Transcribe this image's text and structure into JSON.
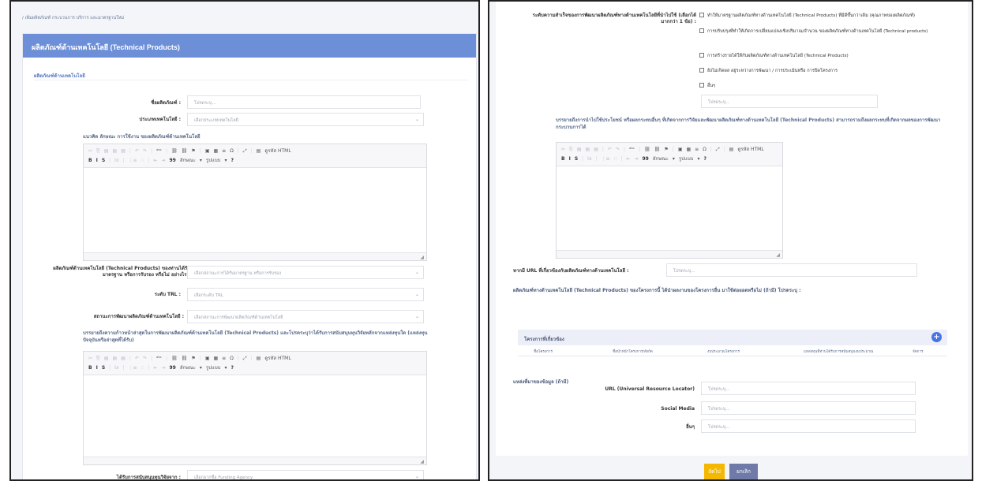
{
  "colors": {
    "header": "#6c8fd8",
    "primary_button": "#f5b800",
    "cancel_button": "#6f7aa8",
    "add_button": "#4674e8"
  },
  "left": {
    "breadcrumb": "/ เพิ่มผลิตภัณฑ์ กระบวนการ บริการ และมาตรฐานใหม่",
    "card_title": "ผลิตภัณฑ์ด้านเทคโนโลยี (Technical Products)",
    "section_title": "ผลิตภัณฑ์ด้านเทคโนโลยี",
    "product_name": {
      "label": "ชื่อผลิตภัณฑ์ :",
      "placeholder": "โปรดระบุ..."
    },
    "tech_type": {
      "label": "ประเภทเทคโนโลยี :",
      "placeholder": "เลือกประเภทเทคโนโลยี"
    },
    "concept_label": "แนวคิด ลักษณะ การใช้งาน ของผลิตภัณฑ์ด้านเทคโนโลยี",
    "certification": {
      "label": "ผลิตภัณฑ์ด้านเทคโนโลยี (Technical Products) ของท่านได้รับมาตรฐาน หรือการรับรอง หรือไม่ อย่างไร :",
      "placeholder": "เลือกสถานะการได้รับมาตรฐาน หรือการรับรอง"
    },
    "trl": {
      "label": "ระดับ TRL :",
      "placeholder": "เลือกระดับ TRL"
    },
    "dev_status": {
      "label": "สถานะการพัฒนาผลิตภัณฑ์ด้านเทคโนโลยี :",
      "placeholder": "เลือกสถานะการพัฒนาผลิตภัณฑ์ด้านเทคโนโลยี"
    },
    "progress_label": "บรรยายถึงความก้าวหน้าล่าสุดในการพัฒนาผลิตภัณฑ์ด้านเทคโนโลยี (Technical Products) และโปรดระบุว่าได้รับการสนับสนุนทุนวิจัยหลักจากแหล่งทุนใด (แหล่งทุนปัจจุบันหรือล่าสุดที่ได้รับ)",
    "funding": {
      "label": "ได้รับการสนับสนุนทุนวิจัยจาก :",
      "placeholder": "เลือกจากชื่อ Funding Agency"
    }
  },
  "editor": {
    "source_label": "ดูรหัส HTML",
    "style_label": "ลักษณะ",
    "format_label": "รูปแบบ",
    "quote": "99",
    "help": "?",
    "row1_icons": [
      "cut-icon",
      "copy-icon",
      "paste-icon",
      "paste-text-icon",
      "paste-word-icon",
      "undo-icon",
      "redo-icon",
      "spellcheck-icon",
      "link-icon",
      "unlink-icon",
      "anchor-icon",
      "image-icon",
      "table-icon",
      "hr-icon",
      "special-char-icon",
      "maximize-icon",
      "source-icon"
    ],
    "row1_glyphs": [
      "✂",
      "⎘",
      "▤",
      "▤",
      "▤",
      "↶",
      "↷",
      "ᵃᵇᶜ",
      "⛓",
      "⛓",
      "⚑",
      "▣",
      "▦",
      "≡",
      "Ω",
      "⤢",
      "▤"
    ],
    "row2_icons": [
      "bold-icon",
      "italic-icon",
      "strike-icon",
      "remove-format-icon",
      "numbered-list-icon",
      "bullet-list-icon",
      "outdent-icon",
      "indent-icon"
    ],
    "row2_glyphs": [
      "B",
      "I",
      "S",
      "Ix",
      "⋮≡",
      "∷",
      "⇤",
      "⇥"
    ],
    "style_arrow": "▾",
    "format_arrow": "▾"
  },
  "right": {
    "success_label": "ระดับความสำเร็จของการพัฒนาผลิตภัณฑ์ทางด้านเทคโนโลยีที่นำไปใช้ (เลือกได้มากกว่า 1 ข้อ) :",
    "success_options": [
      "ทำให้มาตรฐานผลิตภัณฑ์ทางด้านเทคโนโลยี (Technical Products) ที่มีดีขึ้นกว่าเดิม (คุณภาพของผลิตภัณฑ์)",
      "การปรับปรุงที่ทำให้เกิดการเปลี่ยนแปลงเชิงปริมาณ/จำนวน ของผลิตภัณฑ์ทางด้านเทคโนโลยี (Technical products)",
      "การสร้างรายได้ให้กับผลิตภัณฑ์ทางด้านเทคโนโลยี (Technical Products)",
      "ยังไม่เกิดผล อยู่ระหว่างการพัฒนา / การประเมินหรือ การปิดโครงการ",
      "อื่นๆ"
    ],
    "other_placeholder": "โปรดระบุ...",
    "benefit_label": "บรรยายถึงการนำไปใช้ประโยชน์ หรือผลกระทบอื่นๆ ที่เกิดจากการวิจัยและพัฒนาผลิตภัณฑ์ทางด้านเทคโนโลยี (Technical Products) สามารถรวมถึงผลกระทบที่เกิดจากผลของการพัฒนากระบวนการได้",
    "url_question": {
      "label": "หากมี URL ที่เกี่ยวข้องกับผลิตภัณฑ์ทางด้านเทคโนโลยี :",
      "placeholder": "โปรดระบุ..."
    },
    "other_project_label": "ผลิตภัณฑ์ทางด้านเทคโนโลยี (Technical Products) ของโครงการนี้ ได้นำผลงานของโครงการอื่น มาใช้ต่อยอดหรือไม่ (ถ้ามี) โปรดระบุ :",
    "related": {
      "title": "โครงการที่เกี่ยวข้อง",
      "plus": "+",
      "columns": [
        "ชื่อโครงการ",
        "ชื่อนำหน้าโครงการ/สังกัด",
        "งบประมาณโครงการ",
        "แหล่งทุนที่ท่านได้รับการสนับสนุนงบประมาณ",
        "จัดการ"
      ]
    },
    "sources_title": "แหล่งที่มาของข้อมูล (ถ้ามี)",
    "url_field": {
      "label": "URL (Universal Resource Locator)",
      "placeholder": "โปรดระบุ..."
    },
    "social_field": {
      "label": "Social Media",
      "placeholder": "โปรดระบุ..."
    },
    "other_field": {
      "label": "อื่นๆ",
      "placeholder": "โปรดระบุ..."
    },
    "next_button": "ถัดไป",
    "cancel_button": "ยกเลิก"
  }
}
